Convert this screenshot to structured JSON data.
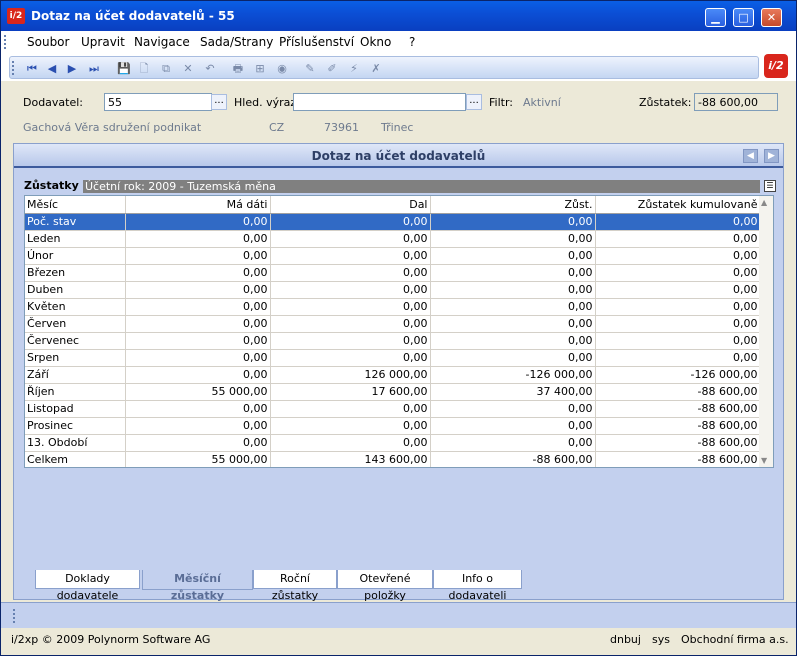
{
  "window": {
    "title": "Dotaz na účet dodavatelů - 55",
    "logo": "i/2",
    "minimize": "▁",
    "maximize": "□",
    "close": "✕"
  },
  "menu": [
    "Soubor",
    "Upravit",
    "Navigace",
    "Sada/Strany",
    "Příslušenství",
    "Okno",
    "?"
  ],
  "toolbar": {
    "icons": [
      "first-record-icon",
      "prev-record-icon",
      "next-record-icon",
      "last-record-icon",
      "save-icon",
      "new-icon",
      "copy-icon",
      "delete-icon",
      "undo-icon",
      "print-icon",
      "tree-icon",
      "refresh-icon",
      "edit-icon",
      "pen-icon",
      "filter-icon",
      "clear-filter-icon"
    ],
    "glyphs": [
      "⏮",
      "◀",
      "▶",
      "⏭",
      "💾",
      "🗋",
      "⧉",
      "✕",
      "↶",
      "🖶",
      "⊞",
      "◉",
      "✎",
      "✐",
      "⚡",
      "✗"
    ]
  },
  "form": {
    "supplier_label": "Dodavatel:",
    "supplier_value": "55",
    "search_label": "Hled. výraz:",
    "search_value": "",
    "filter_label": "Filtr:",
    "filter_value": "Aktivní",
    "balance_label": "Zůstatek:",
    "balance_value": "-88 600,00",
    "supplier_name": "Gachová Věra sdružení podnikat",
    "country": "CZ",
    "zip": "73961",
    "city": "Třinec",
    "dots": "..."
  },
  "panel": {
    "title": "Dotaz na účet dodavatelů",
    "group_label": "Zůstatky",
    "group_info": "Účetní rok: 2009  -  Tuzemská měna",
    "columns": [
      "Měsíc",
      "Má dáti",
      "Dal",
      "Zůst.",
      "Zůstatek kumulovaně"
    ],
    "rows": [
      [
        "Poč. stav",
        "0,00",
        "0,00",
        "0,00",
        "0,00"
      ],
      [
        "Leden",
        "0,00",
        "0,00",
        "0,00",
        "0,00"
      ],
      [
        "Únor",
        "0,00",
        "0,00",
        "0,00",
        "0,00"
      ],
      [
        "Březen",
        "0,00",
        "0,00",
        "0,00",
        "0,00"
      ],
      [
        "Duben",
        "0,00",
        "0,00",
        "0,00",
        "0,00"
      ],
      [
        "Květen",
        "0,00",
        "0,00",
        "0,00",
        "0,00"
      ],
      [
        "Červen",
        "0,00",
        "0,00",
        "0,00",
        "0,00"
      ],
      [
        "Červenec",
        "0,00",
        "0,00",
        "0,00",
        "0,00"
      ],
      [
        "Srpen",
        "0,00",
        "0,00",
        "0,00",
        "0,00"
      ],
      [
        "Září",
        "0,00",
        "126 000,00",
        "-126 000,00",
        "-126 000,00"
      ],
      [
        "Říjen",
        "55 000,00",
        "17 600,00",
        "37 400,00",
        "-88 600,00"
      ],
      [
        "Listopad",
        "0,00",
        "0,00",
        "0,00",
        "-88 600,00"
      ],
      [
        "Prosinec",
        "0,00",
        "0,00",
        "0,00",
        "-88 600,00"
      ],
      [
        "13. Období",
        "0,00",
        "0,00",
        "0,00",
        "-88 600,00"
      ],
      [
        "Celkem",
        "55 000,00",
        "143 600,00",
        "-88 600,00",
        "-88 600,00"
      ]
    ],
    "tabs": [
      "Doklady dodavatele",
      "Měsíční zůstatky",
      "Roční zůstatky",
      "Otevřené položky",
      "Info o dodavateli"
    ]
  },
  "status": {
    "left": "i/2xp © 2009 Polynorm Software AG",
    "user": "dnbuj",
    "db": "sys",
    "company": "Obchodní firma a.s."
  }
}
